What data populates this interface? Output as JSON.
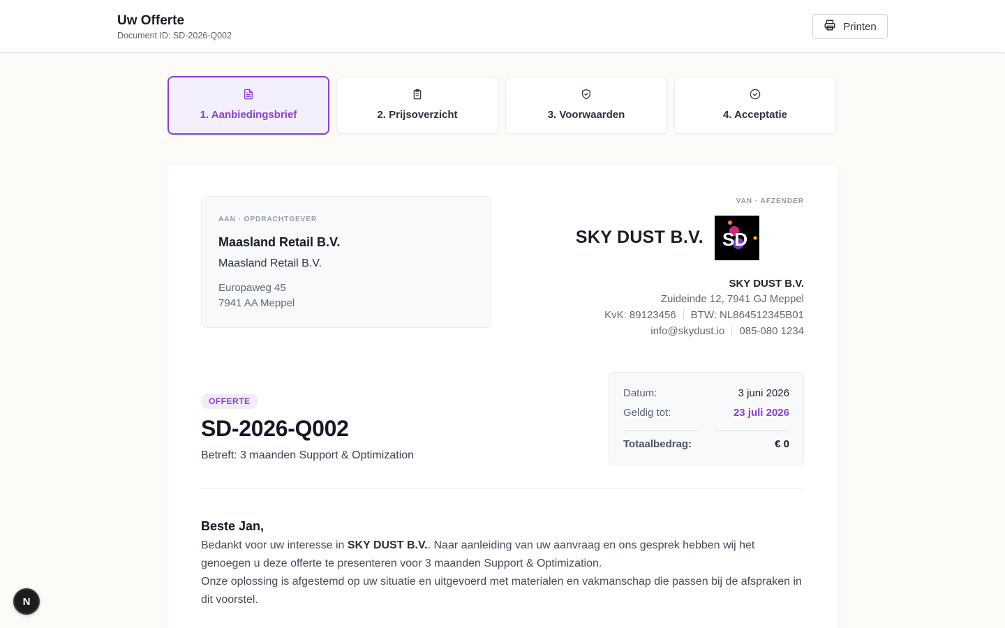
{
  "header": {
    "title": "Uw Offerte",
    "document_id": "Document ID: SD-2026-Q002",
    "print_label": "Printen"
  },
  "tabs": [
    {
      "label": "1. Aanbiedingsbrief",
      "icon": "file-text-icon",
      "active": true
    },
    {
      "label": "2. Prijsoverzicht",
      "icon": "clipboard-list-icon",
      "active": false
    },
    {
      "label": "3. Voorwaarden",
      "icon": "shield-check-icon",
      "active": false
    },
    {
      "label": "4. Acceptatie",
      "icon": "circle-check-icon",
      "active": false
    }
  ],
  "client": {
    "eyebrow": "AAN · OPDRACHTGEVER",
    "name": "Maasland Retail B.V.",
    "company": "Maasland Retail B.V.",
    "street": "Europaweg 45",
    "city": "7941 AA Meppel"
  },
  "sender": {
    "eyebrow": "VAN · AFZENDER",
    "brand": "SKY DUST B.V.",
    "logo_text": "SD",
    "name": "SKY DUST B.V.",
    "address": "Zuideinde 12, 7941 GJ Meppel",
    "kvk": "KvK: 89123456",
    "btw": "BTW: NL864512345B01",
    "email": "info@skydust.io",
    "phone": "085-080 1234"
  },
  "quote": {
    "badge": "OFFERTE",
    "id": "SD-2026-Q002",
    "subject": "Betreft: 3 maanden Support & Optimization"
  },
  "meta": {
    "date_label": "Datum:",
    "date_value": "3 juni 2026",
    "valid_label": "Geldig tot:",
    "valid_value": "23 juli 2026",
    "total_label": "Totaalbedrag:",
    "total_value": "€ 0"
  },
  "letter": {
    "greeting": "Beste Jan,",
    "p1_pre": "Bedankt voor uw interesse in ",
    "p1_brand": "SKY DUST B.V.",
    "p1_post": ". Naar aanleiding van uw aanvraag en ons gesprek hebben wij het genoegen u deze offerte te presenteren voor 3 maanden Support & Optimization.",
    "p2": "Onze oplossing is afgestemd op uw situatie en uitgevoerd met materialen en vakmanschap die passen bij de afspraken in dit voorstel."
  },
  "floating_badge": "N",
  "colors": {
    "accent": "#8b3fd6",
    "background": "#fcfbf8",
    "text": "#1e2430"
  }
}
